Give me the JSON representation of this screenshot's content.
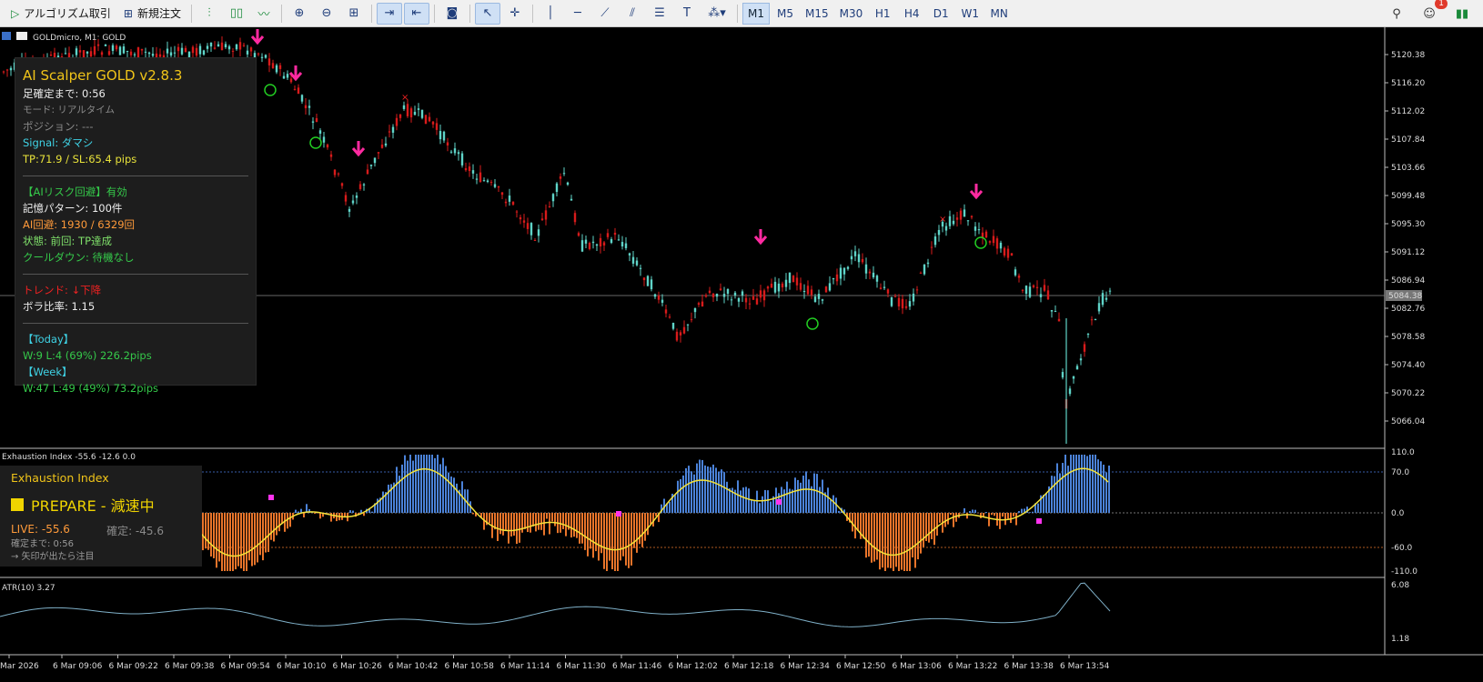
{
  "toolbar": {
    "algo_label": "アルゴリズム取引",
    "new_order_label": "新規注文",
    "timeframes": [
      "M1",
      "M5",
      "M15",
      "M30",
      "H1",
      "H4",
      "D1",
      "W1",
      "MN"
    ],
    "active_timeframe": "M1",
    "notification_count": "1"
  },
  "chart": {
    "symbol_label": "GOLDmicro, M1:  GOLD",
    "price_ticks": [
      "5120.38",
      "5116.20",
      "5112.02",
      "5107.84",
      "5103.66",
      "5099.48",
      "5095.30",
      "5091.12",
      "5086.94",
      "5082.76",
      "5078.58",
      "5074.40",
      "5070.22",
      "5066.04"
    ],
    "current_price": "5084.38",
    "time_ticks": [
      "Mar 2026",
      "6 Mar 09:06",
      "6 Mar 09:22",
      "6 Mar 09:38",
      "6 Mar 09:54",
      "6 Mar 10:10",
      "6 Mar 10:26",
      "6 Mar 10:42",
      "6 Mar 10:58",
      "6 Mar 11:14",
      "6 Mar 11:30",
      "6 Mar 11:46",
      "6 Mar 12:02",
      "6 Mar 12:18",
      "6 Mar 12:34",
      "6 Mar 12:50",
      "6 Mar 13:06",
      "6 Mar 13:22",
      "6 Mar 13:38",
      "6 Mar 13:54"
    ],
    "colors": {
      "bull": "#5fd4c8",
      "bear": "#d81b1b",
      "arrow": "#ff2aa0",
      "circle": "#22cc22",
      "exh_pos": "#4b82d8",
      "exh_neg": "#e8742a",
      "exh_line": "#f3e23b",
      "atr": "#7fb0c8"
    }
  },
  "info_panel": {
    "title": "AI Scalper GOLD v2.8.3",
    "countdown": "足確定まで: 0:56",
    "mode": "モード: リアルタイム",
    "position": "ポジション: ---",
    "signal": "Signal: ダマシ",
    "tp_sl": "TP:71.9 / SL:65.4 pips",
    "risk": "【AIリスク回避】有効",
    "memory": "記憶パターン: 100件",
    "avoid": "AI回避: 1930 / 6329回",
    "status": "状態: 前回: TP達成",
    "cooldown": "クールダウン: 待機なし",
    "trend": "トレンド: ↓下降",
    "vol": "ボラ比率: 1.15",
    "today_label": "【Today】",
    "today": "W:9 L:4 (69%) 226.2pips",
    "week_label": "【Week】",
    "week": "W:47 L:49 (49%) 73.2pips"
  },
  "exhaustion": {
    "header": "Exhaustion Index -55.6 -12.6 0.0",
    "panel_title": "Exhaustion Index",
    "state": "PREPARE - 減速中",
    "live": "LIVE: -55.6",
    "confirmed": "確定: -45.6",
    "countdown": "確定まで: 0:56",
    "hint": "→ 矢印が出たら注目",
    "ticks": [
      "110.0",
      "70.0",
      "0.0",
      "-60.0",
      "-110.0"
    ]
  },
  "atr": {
    "header": "ATR(10) 3.27",
    "ticks": [
      "6.08",
      "1.18"
    ]
  }
}
